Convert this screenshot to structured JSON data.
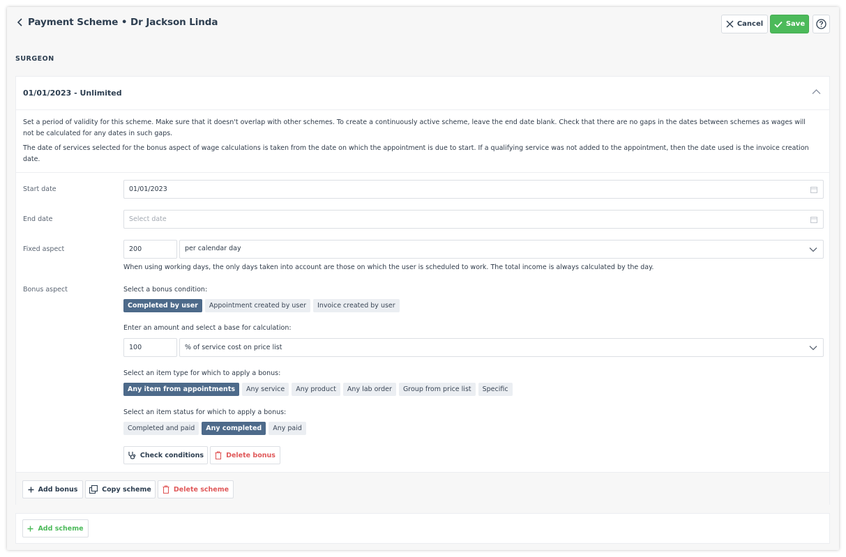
{
  "header": {
    "title": "Payment Scheme • Dr Jackson Linda",
    "cancel_label": "Cancel",
    "save_label": "Save"
  },
  "section_label": "SURGEON",
  "scheme": {
    "period_title": "01/01/2023 - Unlimited",
    "description_1": "Set a period of validity for this scheme. Make sure that it doesn't overlap with other schemes. To create a continuously active scheme, leave the end date blank. Check that there are no gaps in the dates between schemes as wages will not be calculated for any dates in such gaps.",
    "description_2": "The date of services selected for the bonus aspect of wage calculations is taken from the date on which the appointment is due to start. If a qualifying service was not added to the appointment, then the date used is the invoice creation date.",
    "start_date": {
      "label": "Start date",
      "value": "01/01/2023"
    },
    "end_date": {
      "label": "End date",
      "placeholder": "Select date"
    },
    "fixed_aspect": {
      "label": "Fixed aspect",
      "amount": "200",
      "period": "per calendar day",
      "hint": "When using working days, the only days taken into account are those on which the user is scheduled to work. The total income is always calculated by the day."
    },
    "bonus_aspect": {
      "label": "Bonus aspect",
      "condition_heading": "Select a bonus condition:",
      "conditions": [
        {
          "label": "Completed by user",
          "active": true
        },
        {
          "label": "Appointment created by user",
          "active": false
        },
        {
          "label": "Invoice created by user",
          "active": false
        }
      ],
      "amount_heading": "Enter an amount and select a base for calculation:",
      "amount": "100",
      "base": "% of service cost on price list",
      "item_type_heading": "Select an item type for which to apply a bonus:",
      "item_types": [
        {
          "label": "Any item from appointments",
          "active": true
        },
        {
          "label": "Any service",
          "active": false
        },
        {
          "label": "Any product",
          "active": false
        },
        {
          "label": "Any lab order",
          "active": false
        },
        {
          "label": "Group from price list",
          "active": false
        },
        {
          "label": "Specific",
          "active": false
        }
      ],
      "item_status_heading": "Select an item status for which to apply a bonus:",
      "item_statuses": [
        {
          "label": "Completed and paid",
          "active": false
        },
        {
          "label": "Any completed",
          "active": true
        },
        {
          "label": "Any paid",
          "active": false
        }
      ],
      "check_conditions_label": "Check conditions",
      "delete_bonus_label": "Delete bonus"
    },
    "footer": {
      "add_bonus_label": "Add bonus",
      "copy_scheme_label": "Copy scheme",
      "delete_scheme_label": "Delete scheme"
    }
  },
  "add_scheme_label": "Add scheme",
  "colors": {
    "accent": "#4d6a8a",
    "save_green": "#4cba5a",
    "danger": "#e0595a",
    "chip_bg": "#ebeef2"
  },
  "icons": [
    "chevron-left-icon",
    "close-icon",
    "check-icon",
    "help-icon",
    "chevron-up-icon",
    "calendar-icon",
    "chevron-down-icon",
    "stethoscope-icon",
    "trash-icon",
    "plus-icon",
    "copy-icon"
  ]
}
